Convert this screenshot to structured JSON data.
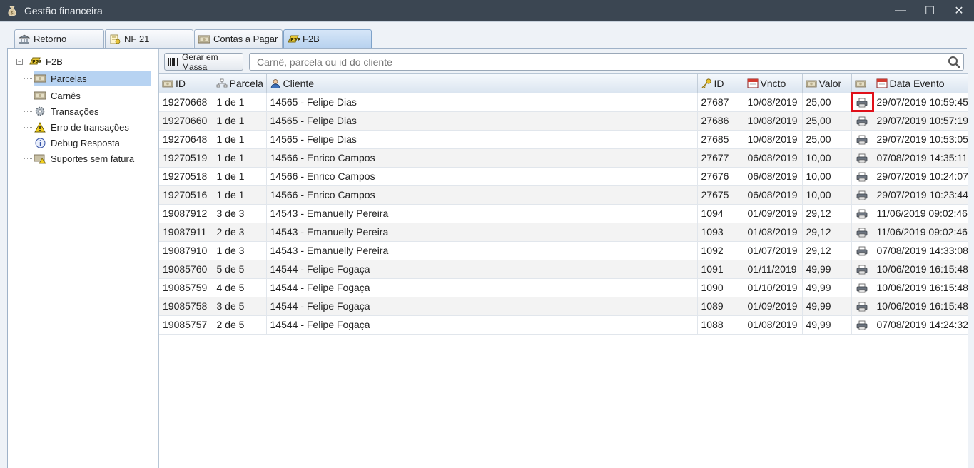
{
  "window": {
    "title": "Gestão financeira",
    "minimize": "—",
    "maximize": "☐",
    "close": "✕"
  },
  "tabs": [
    {
      "label": "Retorno",
      "icon": "bank-icon"
    },
    {
      "label": "NF 21",
      "icon": "invoice-icon"
    },
    {
      "label": "Contas a Pagar",
      "icon": "money-icon"
    },
    {
      "label": "F2B",
      "icon": "f2b-icon",
      "active": true
    }
  ],
  "tree": {
    "root": "F2B",
    "expander": "−",
    "items": [
      {
        "label": "Parcelas",
        "icon": "money-icon",
        "selected": true
      },
      {
        "label": "Carnês",
        "icon": "money-icon"
      },
      {
        "label": "Transações",
        "icon": "gear-icon"
      },
      {
        "label": "Erro de transações",
        "icon": "warning-icon"
      },
      {
        "label": "Debug Resposta",
        "icon": "info-icon"
      },
      {
        "label": "Suportes sem fatura",
        "icon": "money-warning-icon"
      }
    ]
  },
  "toolbar": {
    "mass_button": "Gerar em Massa",
    "search_placeholder": "Carnê, parcela ou id do cliente"
  },
  "table": {
    "headers": [
      "ID",
      "Parcela",
      "Cliente",
      "ID",
      "Vncto",
      "Valor",
      "",
      "Data Evento"
    ],
    "rows": [
      [
        "19270668",
        "1 de 1",
        "14565 - Felipe Dias",
        "27687",
        "10/08/2019",
        "25,00",
        "",
        "29/07/2019 10:59:45"
      ],
      [
        "19270660",
        "1 de 1",
        "14565 - Felipe Dias",
        "27686",
        "10/08/2019",
        "25,00",
        "",
        "29/07/2019 10:57:19"
      ],
      [
        "19270648",
        "1 de 1",
        "14565 - Felipe Dias",
        "27685",
        "10/08/2019",
        "25,00",
        "",
        "29/07/2019 10:53:05"
      ],
      [
        "19270519",
        "1 de 1",
        "14566 - Enrico Campos",
        "27677",
        "06/08/2019",
        "10,00",
        "",
        "07/08/2019 14:35:11"
      ],
      [
        "19270518",
        "1 de 1",
        "14566 - Enrico Campos",
        "27676",
        "06/08/2019",
        "10,00",
        "",
        "29/07/2019 10:24:07"
      ],
      [
        "19270516",
        "1 de 1",
        "14566 - Enrico Campos",
        "27675",
        "06/08/2019",
        "10,00",
        "",
        "29/07/2019 10:23:44"
      ],
      [
        "19087912",
        "3 de 3",
        "14543 - Emanuelly Pereira",
        "1094",
        "01/09/2019",
        "29,12",
        "",
        "11/06/2019 09:02:46"
      ],
      [
        "19087911",
        "2 de 3",
        "14543 - Emanuelly Pereira",
        "1093",
        "01/08/2019",
        "29,12",
        "",
        "11/06/2019 09:02:46"
      ],
      [
        "19087910",
        "1 de 3",
        "14543 - Emanuelly Pereira",
        "1092",
        "01/07/2019",
        "29,12",
        "",
        "07/08/2019 14:33:08"
      ],
      [
        "19085760",
        "5 de 5",
        "14544 - Felipe Fogaça",
        "1091",
        "01/11/2019",
        "49,99",
        "",
        "10/06/2019 16:15:48"
      ],
      [
        "19085759",
        "4 de 5",
        "14544 - Felipe Fogaça",
        "1090",
        "01/10/2019",
        "49,99",
        "",
        "10/06/2019 16:15:48"
      ],
      [
        "19085758",
        "3 de 5",
        "14544 - Felipe Fogaça",
        "1089",
        "01/09/2019",
        "49,99",
        "",
        "10/06/2019 16:15:48"
      ],
      [
        "19085757",
        "2 de 5",
        "14544 - Felipe Fogaça",
        "1088",
        "01/08/2019",
        "49,99",
        "",
        "07/08/2019 14:24:32"
      ]
    ]
  },
  "colors": {
    "titlebar": "#3b4652",
    "selection": "#b7d3f2",
    "highlight": "#e0101a"
  }
}
